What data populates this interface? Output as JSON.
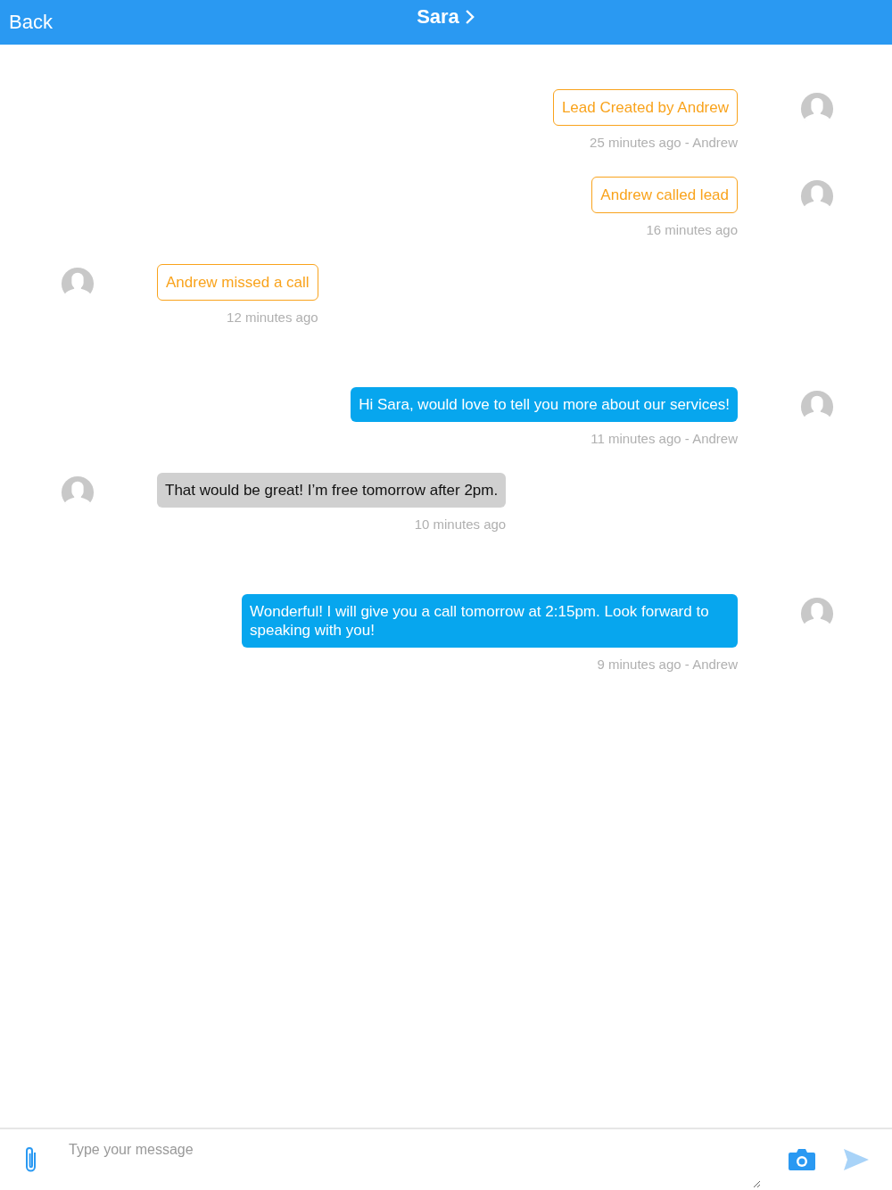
{
  "header": {
    "back": "Back",
    "title": "Sara"
  },
  "messages": [
    {
      "kind": "event",
      "outgoing": true,
      "text": "Lead Created by Andrew",
      "time": "25 minutes ago - Andrew"
    },
    {
      "kind": "event",
      "outgoing": true,
      "text": "Andrew called lead",
      "time": "16 minutes ago"
    },
    {
      "kind": "event",
      "outgoing": false,
      "text": "Andrew missed a call",
      "time": "12 minutes ago"
    },
    {
      "kind": "text",
      "outgoing": true,
      "text": "Hi Sara, would love to tell you more about our services!",
      "time": "11 minutes ago - Andrew"
    },
    {
      "kind": "text",
      "outgoing": false,
      "text": "That would be great! I’m free tomorrow after 2pm.",
      "time": "10 minutes ago"
    },
    {
      "kind": "text",
      "outgoing": true,
      "text": "Wonderful! I will give you a call tomorrow at 2:15pm. Look forward to speaking with you!",
      "time": "9 minutes ago - Andrew"
    }
  ],
  "composer": {
    "placeholder": "Type your message"
  }
}
